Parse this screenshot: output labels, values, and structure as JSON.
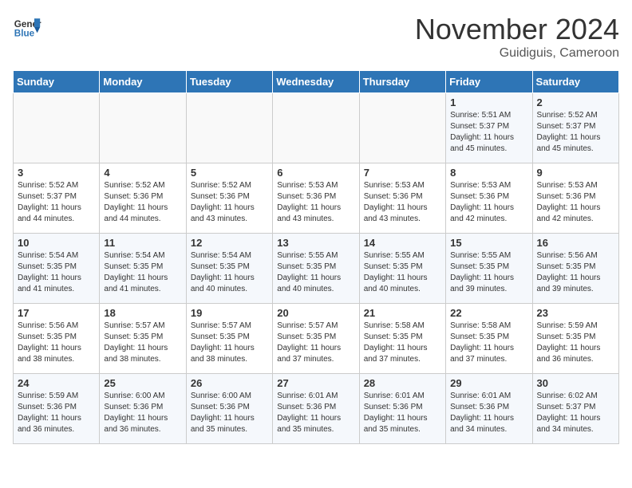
{
  "header": {
    "logo_general": "General",
    "logo_blue": "Blue",
    "month_title": "November 2024",
    "location": "Guidiguis, Cameroon"
  },
  "weekdays": [
    "Sunday",
    "Monday",
    "Tuesday",
    "Wednesday",
    "Thursday",
    "Friday",
    "Saturday"
  ],
  "weeks": [
    [
      {
        "day": "",
        "info": ""
      },
      {
        "day": "",
        "info": ""
      },
      {
        "day": "",
        "info": ""
      },
      {
        "day": "",
        "info": ""
      },
      {
        "day": "",
        "info": ""
      },
      {
        "day": "1",
        "info": "Sunrise: 5:51 AM\nSunset: 5:37 PM\nDaylight: 11 hours\nand 45 minutes."
      },
      {
        "day": "2",
        "info": "Sunrise: 5:52 AM\nSunset: 5:37 PM\nDaylight: 11 hours\nand 45 minutes."
      }
    ],
    [
      {
        "day": "3",
        "info": "Sunrise: 5:52 AM\nSunset: 5:37 PM\nDaylight: 11 hours\nand 44 minutes."
      },
      {
        "day": "4",
        "info": "Sunrise: 5:52 AM\nSunset: 5:36 PM\nDaylight: 11 hours\nand 44 minutes."
      },
      {
        "day": "5",
        "info": "Sunrise: 5:52 AM\nSunset: 5:36 PM\nDaylight: 11 hours\nand 43 minutes."
      },
      {
        "day": "6",
        "info": "Sunrise: 5:53 AM\nSunset: 5:36 PM\nDaylight: 11 hours\nand 43 minutes."
      },
      {
        "day": "7",
        "info": "Sunrise: 5:53 AM\nSunset: 5:36 PM\nDaylight: 11 hours\nand 43 minutes."
      },
      {
        "day": "8",
        "info": "Sunrise: 5:53 AM\nSunset: 5:36 PM\nDaylight: 11 hours\nand 42 minutes."
      },
      {
        "day": "9",
        "info": "Sunrise: 5:53 AM\nSunset: 5:36 PM\nDaylight: 11 hours\nand 42 minutes."
      }
    ],
    [
      {
        "day": "10",
        "info": "Sunrise: 5:54 AM\nSunset: 5:35 PM\nDaylight: 11 hours\nand 41 minutes."
      },
      {
        "day": "11",
        "info": "Sunrise: 5:54 AM\nSunset: 5:35 PM\nDaylight: 11 hours\nand 41 minutes."
      },
      {
        "day": "12",
        "info": "Sunrise: 5:54 AM\nSunset: 5:35 PM\nDaylight: 11 hours\nand 40 minutes."
      },
      {
        "day": "13",
        "info": "Sunrise: 5:55 AM\nSunset: 5:35 PM\nDaylight: 11 hours\nand 40 minutes."
      },
      {
        "day": "14",
        "info": "Sunrise: 5:55 AM\nSunset: 5:35 PM\nDaylight: 11 hours\nand 40 minutes."
      },
      {
        "day": "15",
        "info": "Sunrise: 5:55 AM\nSunset: 5:35 PM\nDaylight: 11 hours\nand 39 minutes."
      },
      {
        "day": "16",
        "info": "Sunrise: 5:56 AM\nSunset: 5:35 PM\nDaylight: 11 hours\nand 39 minutes."
      }
    ],
    [
      {
        "day": "17",
        "info": "Sunrise: 5:56 AM\nSunset: 5:35 PM\nDaylight: 11 hours\nand 38 minutes."
      },
      {
        "day": "18",
        "info": "Sunrise: 5:57 AM\nSunset: 5:35 PM\nDaylight: 11 hours\nand 38 minutes."
      },
      {
        "day": "19",
        "info": "Sunrise: 5:57 AM\nSunset: 5:35 PM\nDaylight: 11 hours\nand 38 minutes."
      },
      {
        "day": "20",
        "info": "Sunrise: 5:57 AM\nSunset: 5:35 PM\nDaylight: 11 hours\nand 37 minutes."
      },
      {
        "day": "21",
        "info": "Sunrise: 5:58 AM\nSunset: 5:35 PM\nDaylight: 11 hours\nand 37 minutes."
      },
      {
        "day": "22",
        "info": "Sunrise: 5:58 AM\nSunset: 5:35 PM\nDaylight: 11 hours\nand 37 minutes."
      },
      {
        "day": "23",
        "info": "Sunrise: 5:59 AM\nSunset: 5:35 PM\nDaylight: 11 hours\nand 36 minutes."
      }
    ],
    [
      {
        "day": "24",
        "info": "Sunrise: 5:59 AM\nSunset: 5:36 PM\nDaylight: 11 hours\nand 36 minutes."
      },
      {
        "day": "25",
        "info": "Sunrise: 6:00 AM\nSunset: 5:36 PM\nDaylight: 11 hours\nand 36 minutes."
      },
      {
        "day": "26",
        "info": "Sunrise: 6:00 AM\nSunset: 5:36 PM\nDaylight: 11 hours\nand 35 minutes."
      },
      {
        "day": "27",
        "info": "Sunrise: 6:01 AM\nSunset: 5:36 PM\nDaylight: 11 hours\nand 35 minutes."
      },
      {
        "day": "28",
        "info": "Sunrise: 6:01 AM\nSunset: 5:36 PM\nDaylight: 11 hours\nand 35 minutes."
      },
      {
        "day": "29",
        "info": "Sunrise: 6:01 AM\nSunset: 5:36 PM\nDaylight: 11 hours\nand 34 minutes."
      },
      {
        "day": "30",
        "info": "Sunrise: 6:02 AM\nSunset: 5:37 PM\nDaylight: 11 hours\nand 34 minutes."
      }
    ]
  ]
}
